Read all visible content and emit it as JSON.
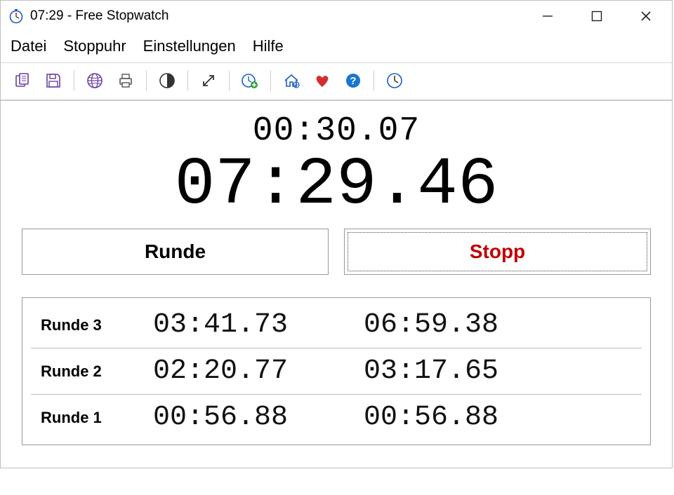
{
  "window": {
    "title": "07:29 - Free Stopwatch"
  },
  "menu": {
    "items": [
      "Datei",
      "Stoppuhr",
      "Einstellungen",
      "Hilfe"
    ]
  },
  "toolbar": {
    "icons": [
      "copy-icon",
      "save-icon",
      "globe-icon",
      "print-icon",
      "contrast-icon",
      "fullscreen-icon",
      "add-clock-icon",
      "home-icon",
      "heart-icon",
      "help-icon",
      "clock-icon"
    ]
  },
  "display": {
    "lap_time": "00:30.07",
    "main_time": "07:29.46"
  },
  "buttons": {
    "lap": "Runde",
    "stop": "Stopp"
  },
  "laps": [
    {
      "label": "Runde 3",
      "split": "03:41.73",
      "total": "06:59.38"
    },
    {
      "label": "Runde 2",
      "split": "02:20.77",
      "total": "03:17.65"
    },
    {
      "label": "Runde 1",
      "split": "00:56.88",
      "total": "00:56.88"
    }
  ]
}
